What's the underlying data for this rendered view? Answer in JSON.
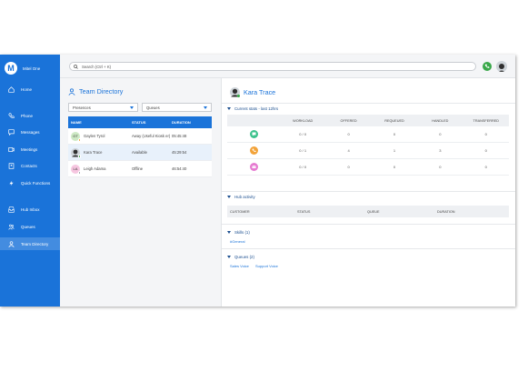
{
  "app": {
    "brand_name": "Mitel One",
    "brand_initial": "M",
    "accent_color": "#1a73d9"
  },
  "sidebar": {
    "items": [
      {
        "label": "Home",
        "icon": "home-icon"
      },
      {
        "label": "Phone",
        "icon": "phone-icon"
      },
      {
        "label": "Messages",
        "icon": "chat-icon"
      },
      {
        "label": "Meetings",
        "icon": "video-icon"
      },
      {
        "label": "Contacts",
        "icon": "contacts-icon"
      },
      {
        "label": "Quick Functions",
        "icon": "lightning-icon"
      },
      {
        "label": "Hub Inbox",
        "icon": "inbox-icon"
      },
      {
        "label": "Queues",
        "icon": "queues-icon"
      },
      {
        "label": "Team Directory",
        "icon": "person-icon",
        "active": true
      }
    ]
  },
  "topbar": {
    "search_placeholder": "Search (Ctrl + K)",
    "status_color": "#3aa84a"
  },
  "directory": {
    "title": "Team Directory",
    "filter_presences": "Presences",
    "filter_queues": "Queues",
    "columns": {
      "name": "NAME",
      "status": "STATUS",
      "duration": "DURATION"
    },
    "rows": [
      {
        "initials": "GT",
        "name": "Gaylen Tyrol",
        "status": "Away (Useful Kiosk er)",
        "duration": "05:45:48",
        "avatar_color": "#cde9c4",
        "presence_color": "#f2a33a"
      },
      {
        "initials": "KT",
        "name": "Kara Trace",
        "status": "Available",
        "duration": "45:29:54",
        "avatar_color": "#2f2f2f",
        "presence_color": "#3aa84a",
        "selected": true
      },
      {
        "initials": "LA",
        "name": "Leigh Adama",
        "status": "Offline",
        "duration": "46:54:40",
        "avatar_color": "#f6c6e0",
        "presence_color": "#9aa0a6"
      }
    ]
  },
  "detail": {
    "name": "Kara Trace",
    "stats_title": "Current stats - last 12hrs",
    "stats_columns": [
      "WORKLOAD",
      "OFFERED",
      "REQUEUED",
      "HANDLED",
      "TRANSFERRED"
    ],
    "stats_rows": [
      {
        "channel": "chat",
        "color": "#3cc28c",
        "workload": "0 / 0",
        "offered": "0",
        "requeued": "0",
        "handled": "0",
        "transferred": "0"
      },
      {
        "channel": "phone",
        "color": "#f2a33a",
        "workload": "0 / 1",
        "offered": "4",
        "requeued": "1",
        "handled": "3",
        "transferred": "0"
      },
      {
        "channel": "email",
        "color": "#e67bd1",
        "workload": "0 / 0",
        "offered": "0",
        "requeued": "0",
        "handled": "0",
        "transferred": "0"
      }
    ],
    "hub_title": "Hub activity",
    "hub_columns": [
      "CUSTOMER",
      "STATUS",
      "QUEUE",
      "DURATION"
    ],
    "skills_title": "Skills (1)",
    "skills": [
      "#General"
    ],
    "queues_title": "Queues (2)",
    "queues": [
      "Sales Voice",
      "Support Voice"
    ]
  }
}
